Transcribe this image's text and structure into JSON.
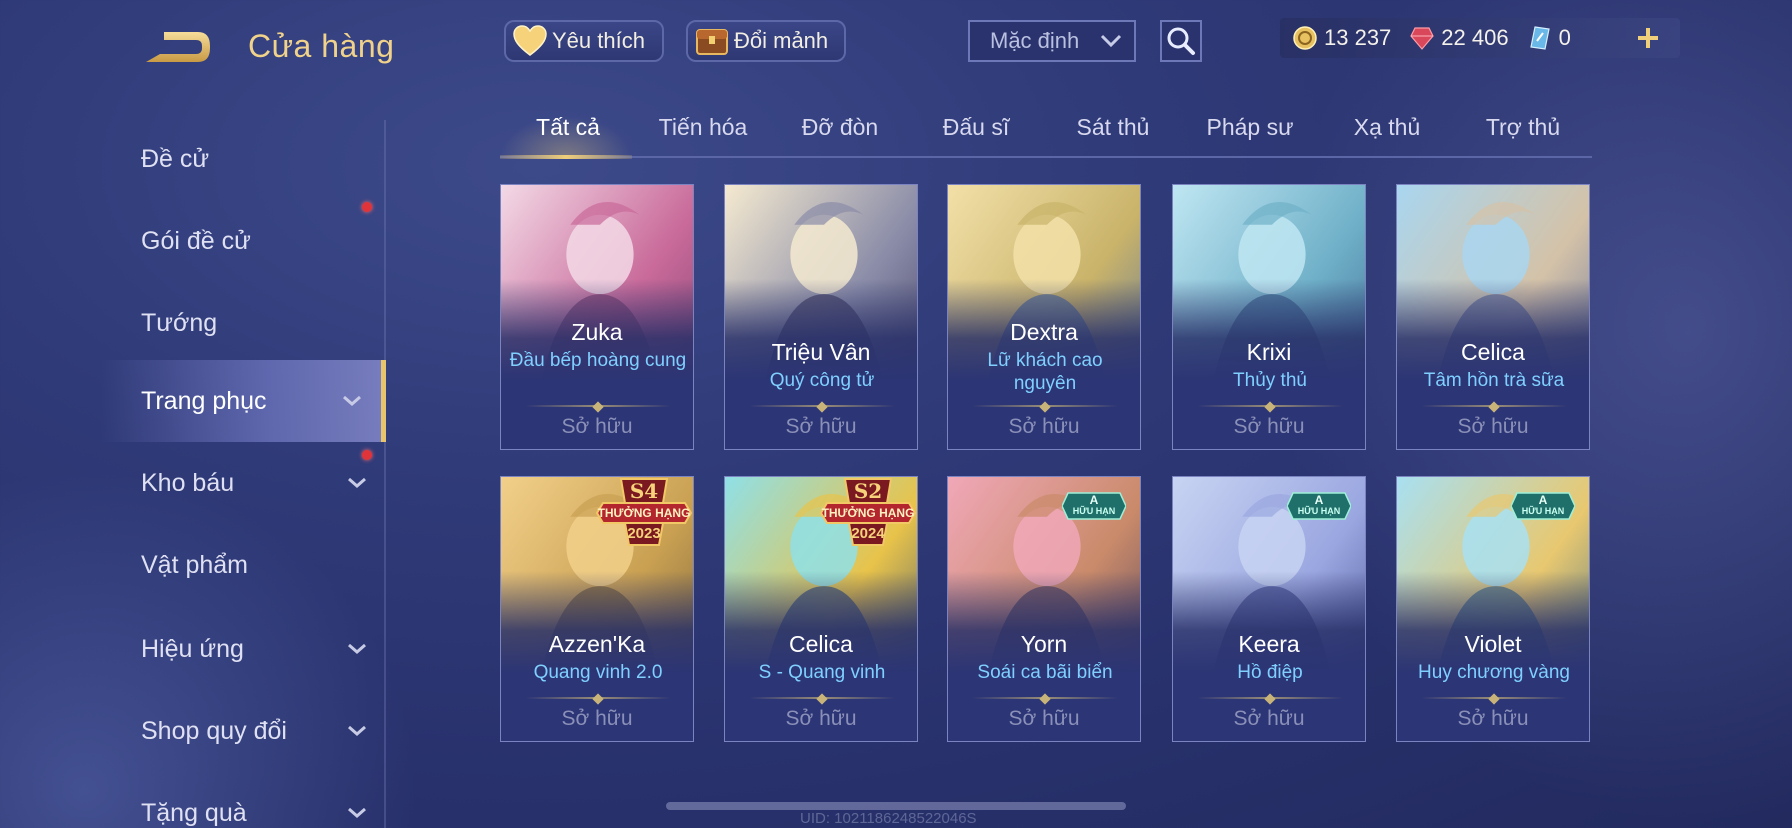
{
  "header": {
    "title": "Cửa hàng",
    "favorite_label": "Yêu thích",
    "exchange_label": "Đổi mảnh",
    "sort_value": "Mặc định"
  },
  "currencies": [
    {
      "icon": "gold-coin-icon",
      "value": "13 237"
    },
    {
      "icon": "ruby-gem-icon",
      "value": "22 406"
    },
    {
      "icon": "voucher-icon",
      "value": "0"
    }
  ],
  "sidebar": {
    "items": [
      {
        "label": "Đề cử",
        "has_chevron": false,
        "badge": false
      },
      {
        "label": "Gói đề cử",
        "has_chevron": false,
        "badge": true
      },
      {
        "label": "Tướng",
        "has_chevron": false,
        "badge": false
      },
      {
        "label": "Trang phục",
        "has_chevron": true,
        "badge": false,
        "active": true
      },
      {
        "label": "Kho báu",
        "has_chevron": true,
        "badge": true
      },
      {
        "label": "Vật phẩm",
        "has_chevron": false,
        "badge": false
      },
      {
        "label": "Hiệu ứng",
        "has_chevron": true,
        "badge": false
      },
      {
        "label": "Shop quy đổi",
        "has_chevron": true,
        "badge": false
      },
      {
        "label": "Tặng quà",
        "has_chevron": true,
        "badge": false
      }
    ]
  },
  "tabs": [
    "Tất cả",
    "Tiến hóa",
    "Đỡ đòn",
    "Đấu sĩ",
    "Sát thủ",
    "Pháp sư",
    "Xạ thủ",
    "Trợ thủ"
  ],
  "active_tab": 0,
  "cards": [
    {
      "hero": "Zuka",
      "skin": "Đầu bếp hoàng cung",
      "status": "Sở hữu",
      "palette": [
        "#f3d9e6",
        "#c96a9a",
        "#7a3f6d"
      ],
      "badge": null
    },
    {
      "hero": "Triệu Vân",
      "skin": "Quý công tử",
      "status": "Sở hữu",
      "palette": [
        "#f5ead0",
        "#8a8ca8",
        "#3f3a5e"
      ],
      "badge": null
    },
    {
      "hero": "Dextra",
      "skin": "Lữ khách cao nguyên",
      "status": "Sở hữu",
      "palette": [
        "#f2e0a8",
        "#c9b36a",
        "#4a6aa0"
      ],
      "badge": null
    },
    {
      "hero": "Krixi",
      "skin": "Thủy thủ",
      "status": "Sở hữu",
      "palette": [
        "#bfe6f2",
        "#6fb0c8",
        "#3a5f8a"
      ],
      "badge": null
    },
    {
      "hero": "Celica",
      "skin": "Tâm hồn trà sữa",
      "status": "Sở hữu",
      "palette": [
        "#a9d6f0",
        "#d4c2a8",
        "#5a6a9a"
      ],
      "badge": null
    },
    {
      "hero": "Azzen'Ka",
      "skin": "Quang vinh 2.0",
      "status": "Sở hữu",
      "palette": [
        "#f2d08a",
        "#c9a052",
        "#6e5a3a"
      ],
      "badge": {
        "type": "rank",
        "season": "S4",
        "text": "THƯỞNG HẠNG",
        "year": "2023"
      }
    },
    {
      "hero": "Celica",
      "skin": "S - Quang vinh",
      "status": "Sở hữu",
      "palette": [
        "#8fe0e8",
        "#e8c34a",
        "#2f4a7a"
      ],
      "badge": {
        "type": "rank",
        "season": "S2",
        "text": "THƯỞNG HẠNG",
        "year": "2024"
      }
    },
    {
      "hero": "Yorn",
      "skin": "Soái ca bãi biển",
      "status": "Sở hữu",
      "palette": [
        "#f0a8b8",
        "#c98a6a",
        "#4a3f5e"
      ],
      "badge": {
        "type": "rare",
        "grade": "A",
        "text": "HỮU HẠN"
      }
    },
    {
      "hero": "Keera",
      "skin": "Hồ điệp",
      "status": "Sở hữu",
      "palette": [
        "#c8d4f2",
        "#9aa6e0",
        "#3f4a8a"
      ],
      "badge": {
        "type": "rare",
        "grade": "A",
        "text": "HỮU HẠN"
      }
    },
    {
      "hero": "Violet",
      "skin": "Huy chương vàng",
      "status": "Sở hữu",
      "palette": [
        "#a8e0f2",
        "#e8c870",
        "#3a6a8a"
      ],
      "badge": {
        "type": "rare",
        "grade": "A",
        "text": "HỮU HẠN"
      }
    }
  ],
  "uid": "UID: 1021186248522046S"
}
